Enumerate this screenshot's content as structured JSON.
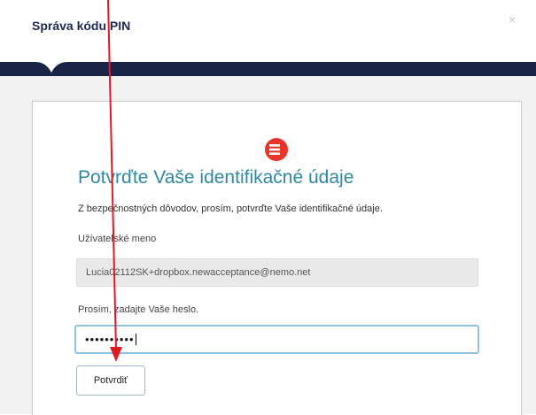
{
  "dialog": {
    "title": "Správa kódu PIN",
    "close_icon": "close-icon",
    "close_glyph": "×"
  },
  "card": {
    "logo_icon": "brand-logo-icon",
    "title": "Potvrďte Vaše identifikačné údaje",
    "subtitle": "Z bezpečnostných dôvodov, prosím, potvrďte Vaše identifikačné údaje.",
    "username_label": "Užívateľské meno",
    "username_value": "Lucia02112SK+dropbox.newacceptance@nemo.net",
    "password_label": "Prosím, zadajte Vaše heslo.",
    "password_mask": "••••••••••",
    "confirm_button": "Potvrdiť"
  },
  "colors": {
    "brand_red": "#e8342a",
    "title_teal": "#2e89a1",
    "nav_band": "#1a2447",
    "annotation_arrow": "#e01b24"
  }
}
